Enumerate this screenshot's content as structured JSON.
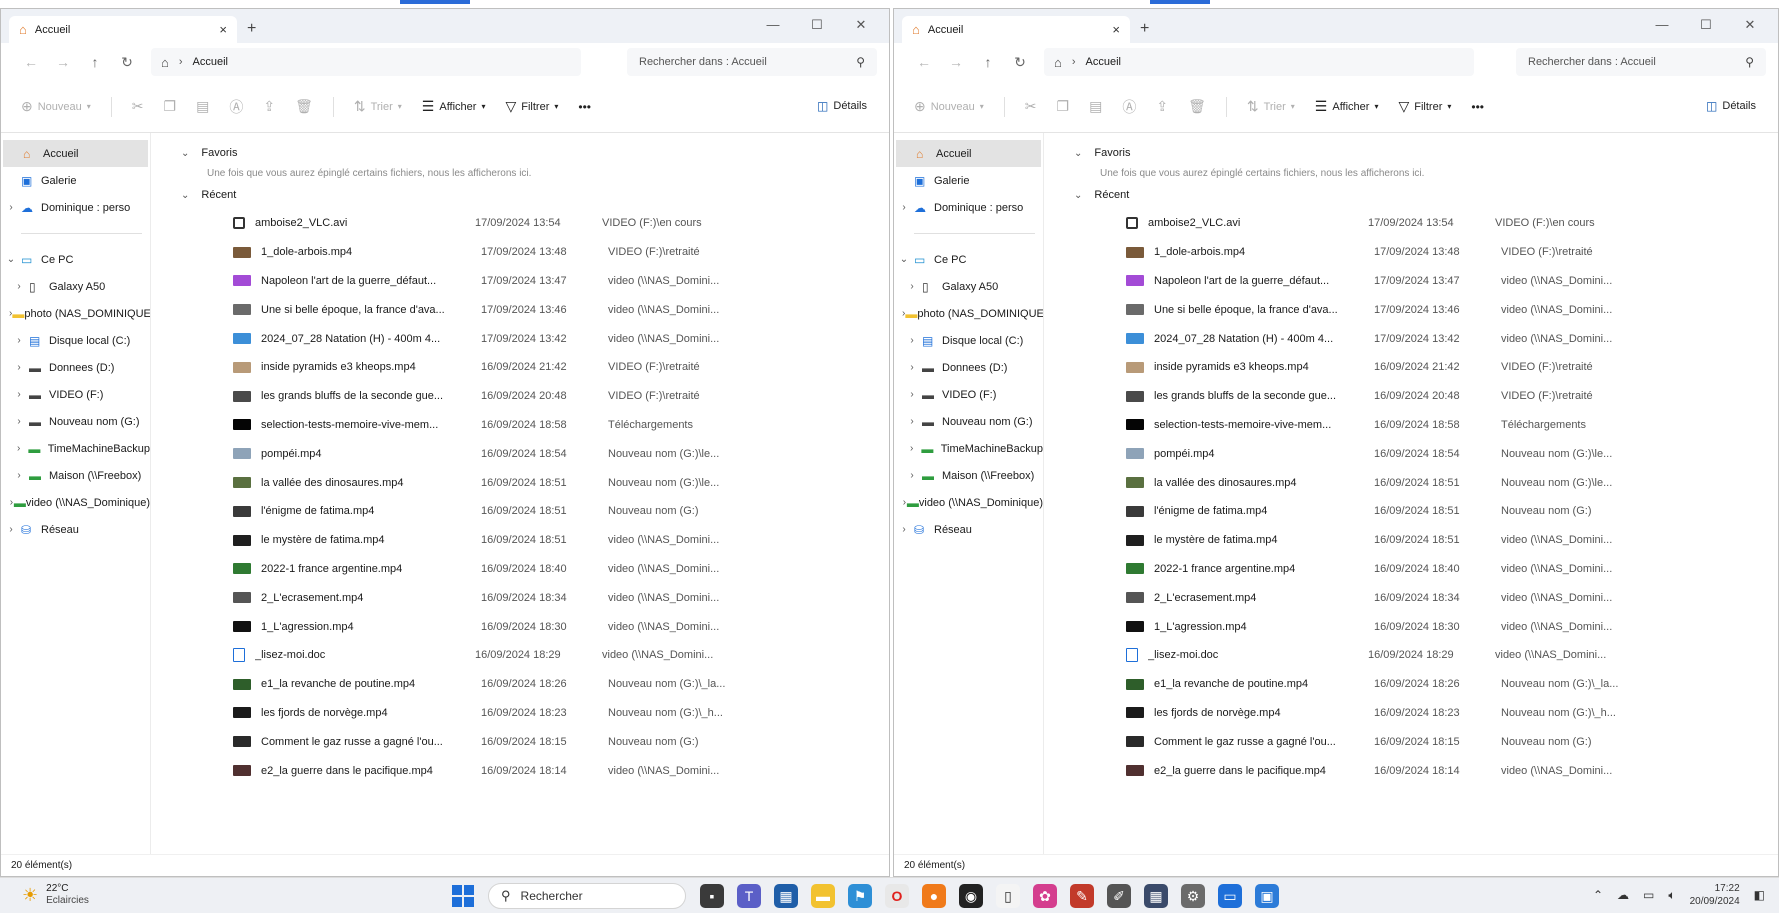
{
  "windows": [
    {
      "tab_title": "Accueil",
      "breadcrumb": "Accueil",
      "search_placeholder": "Rechercher dans : Accueil",
      "toolbar": {
        "new": "Nouveau",
        "sort": "Trier",
        "view": "Afficher",
        "filter": "Filtrer",
        "more": "•••",
        "details": "Détails"
      },
      "sidebar": {
        "home": "Accueil",
        "gallery": "Galerie",
        "onedrive": "Dominique : perso",
        "this_pc": "Ce PC",
        "drives": [
          "Galaxy A50",
          "photo (NAS_DOMINIQUE)",
          "Disque local (C:)",
          "Donnees (D:)",
          "VIDEO (F:)",
          "Nouveau nom (G:)",
          "TimeMachineBackup",
          "Maison (\\\\Freebox)",
          "video (\\\\NAS_Dominique)"
        ],
        "network": "Réseau"
      },
      "favorites_title": "Favoris",
      "favorites_note": "Une fois que vous aurez épinglé certains fichiers, nous les afficherons ici.",
      "recent_title": "Récent",
      "status": "20 élément(s)"
    },
    {
      "tab_title": "Accueil",
      "breadcrumb": "Accueil",
      "search_placeholder": "Rechercher dans : Accueil",
      "toolbar": {
        "new": "Nouveau",
        "sort": "Trier",
        "view": "Afficher",
        "filter": "Filtrer",
        "more": "•••",
        "details": "Détails"
      },
      "sidebar": {
        "home": "Accueil",
        "gallery": "Galerie",
        "onedrive": "Dominique : perso",
        "this_pc": "Ce PC",
        "drives": [
          "Galaxy A50",
          "photo (NAS_DOMINIQUE)",
          "Disque local (C:)",
          "Donnees (D:)",
          "VIDEO (F:)",
          "Nouveau nom (G:)",
          "TimeMachineBackup",
          "Maison (\\\\Freebox)",
          "video (\\\\NAS_Dominique)"
        ],
        "network": "Réseau"
      },
      "favorites_title": "Favoris",
      "favorites_note": "Une fois que vous aurez épinglé certains fichiers, nous les afficherons ici.",
      "recent_title": "Récent",
      "status": "20 élément(s)"
    }
  ],
  "recent_files": [
    {
      "name": "amboise2_VLC.avi",
      "date": "17/09/2024 13:54",
      "location": "VIDEO (F:)\\en cours",
      "thumb": "#2b2b2b"
    },
    {
      "name": "1_dole-arbois.mp4",
      "date": "17/09/2024 13:48",
      "location": "VIDEO (F:)\\retraité",
      "thumb": "#7a5a3a"
    },
    {
      "name": "Napoleon l'art de la guerre_défaut...",
      "date": "17/09/2024 13:47",
      "location": "video (\\\\NAS_Domini...",
      "thumb": "#a34bd6"
    },
    {
      "name": "Une si belle époque, la france d'ava...",
      "date": "17/09/2024 13:46",
      "location": "video (\\\\NAS_Domini...",
      "thumb": "#6a6a6a"
    },
    {
      "name": "2024_07_28 Natation (H) - 400m 4...",
      "date": "17/09/2024 13:42",
      "location": "video (\\\\NAS_Domini...",
      "thumb": "#3c8fd8"
    },
    {
      "name": "inside pyramids e3 kheops.mp4",
      "date": "16/09/2024 21:42",
      "location": "VIDEO (F:)\\retraité",
      "thumb": "#b89a78"
    },
    {
      "name": "les grands bluffs de la seconde gue...",
      "date": "16/09/2024 20:48",
      "location": "VIDEO (F:)\\retraité",
      "thumb": "#4a4a4a"
    },
    {
      "name": "selection-tests-memoire-vive-mem...",
      "date": "16/09/2024 18:58",
      "location": "Téléchargements",
      "thumb": "#050505"
    },
    {
      "name": "pompéi.mp4",
      "date": "16/09/2024 18:54",
      "location": "Nouveau nom (G:)\\le...",
      "thumb": "#8ea3b8"
    },
    {
      "name": "la vallée des dinosaures.mp4",
      "date": "16/09/2024 18:51",
      "location": "Nouveau nom (G:)\\le...",
      "thumb": "#5a7040"
    },
    {
      "name": "l'énigme de fatima.mp4",
      "date": "16/09/2024 18:51",
      "location": "Nouveau nom (G:)",
      "thumb": "#3a3a3a"
    },
    {
      "name": "le mystère de fatima.mp4",
      "date": "16/09/2024 18:51",
      "location": "video (\\\\NAS_Domini...",
      "thumb": "#1f1f1f"
    },
    {
      "name": "2022-1 france argentine.mp4",
      "date": "16/09/2024 18:40",
      "location": "video (\\\\NAS_Domini...",
      "thumb": "#2f7a32"
    },
    {
      "name": "2_L'ecrasement.mp4",
      "date": "16/09/2024 18:34",
      "location": "video (\\\\NAS_Domini...",
      "thumb": "#555555"
    },
    {
      "name": "1_L'agression.mp4",
      "date": "16/09/2024 18:30",
      "location": "video (\\\\NAS_Domini...",
      "thumb": "#111111"
    },
    {
      "name": "_lisez-moi.doc",
      "date": "16/09/2024 18:29",
      "location": "video (\\\\NAS_Domini...",
      "thumb": "#ffffff"
    },
    {
      "name": "e1_la revanche de poutine.mp4",
      "date": "16/09/2024 18:26",
      "location": "Nouveau nom (G:)\\_la...",
      "thumb": "#2e5e2a"
    },
    {
      "name": "les fjords de norvège.mp4",
      "date": "16/09/2024 18:23",
      "location": "Nouveau nom (G:)\\_h...",
      "thumb": "#1b1b1b"
    },
    {
      "name": "Comment le gaz russe a gagné l'ou...",
      "date": "16/09/2024 18:15",
      "location": "Nouveau nom (G:)",
      "thumb": "#2a2a2a"
    },
    {
      "name": "e2_la guerre dans le pacifique.mp4",
      "date": "16/09/2024 18:14",
      "location": "video (\\\\NAS_Domini...",
      "thumb": "#503030"
    }
  ],
  "taskbar": {
    "weather_temp": "22°C",
    "weather_desc": "Eclaircies",
    "search_label": "Rechercher",
    "time": "17:22",
    "date": "20/09/2024"
  },
  "colors": {
    "accent": "#1e6fd9",
    "folder": "#f2c230",
    "selected": "#e3e3e3"
  }
}
